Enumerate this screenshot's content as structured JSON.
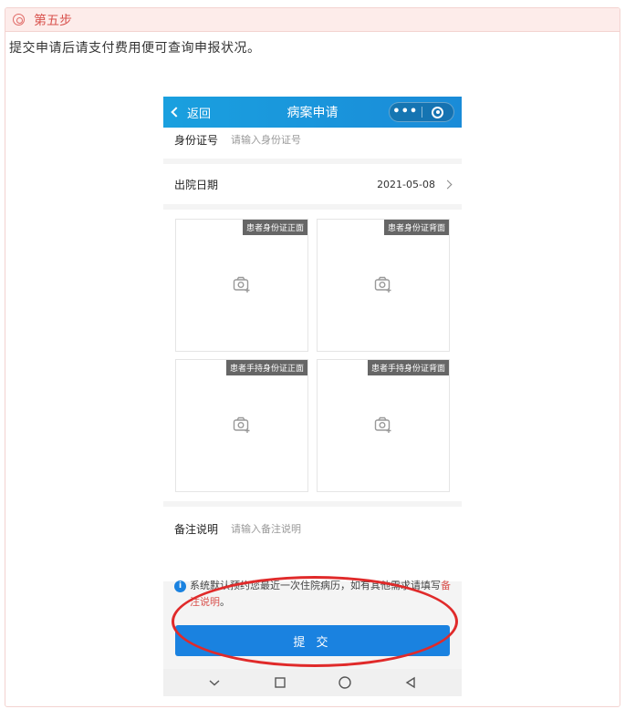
{
  "step": {
    "title": "第五步"
  },
  "description": "提交申请后请支付费用便可查询申报状况。",
  "phone": {
    "nav": {
      "back_label": "返回",
      "title": "病案申请",
      "menu_dots": "•••"
    },
    "id_row": {
      "label": "身份证号",
      "placeholder": "请输入身份证号"
    },
    "date_row": {
      "label": "出院日期",
      "value": "2021-05-08"
    },
    "photos": [
      {
        "tag": "患者身份证正面"
      },
      {
        "tag": "患者身份证背面"
      },
      {
        "tag": "患者手持身份证正面"
      },
      {
        "tag": "患者手持身份证背面"
      }
    ],
    "note_row": {
      "label": "备注说明",
      "placeholder": "请输入备注说明"
    },
    "notice": {
      "icon": "i",
      "text_main": "系统默认预约您最近一次住院病历，如有其他需求请填写",
      "link": "备注说明",
      "tail": "。"
    },
    "submit_label": "提 交"
  },
  "icons": {
    "step": "circle-icon",
    "back": "chevron-left-icon",
    "camera": "camera-add-icon"
  },
  "colors": {
    "accent_red": "#d9534f",
    "nav_blue": "#1a8bd8",
    "button_blue": "#1a82e0",
    "annotation": "#e02a2a"
  }
}
